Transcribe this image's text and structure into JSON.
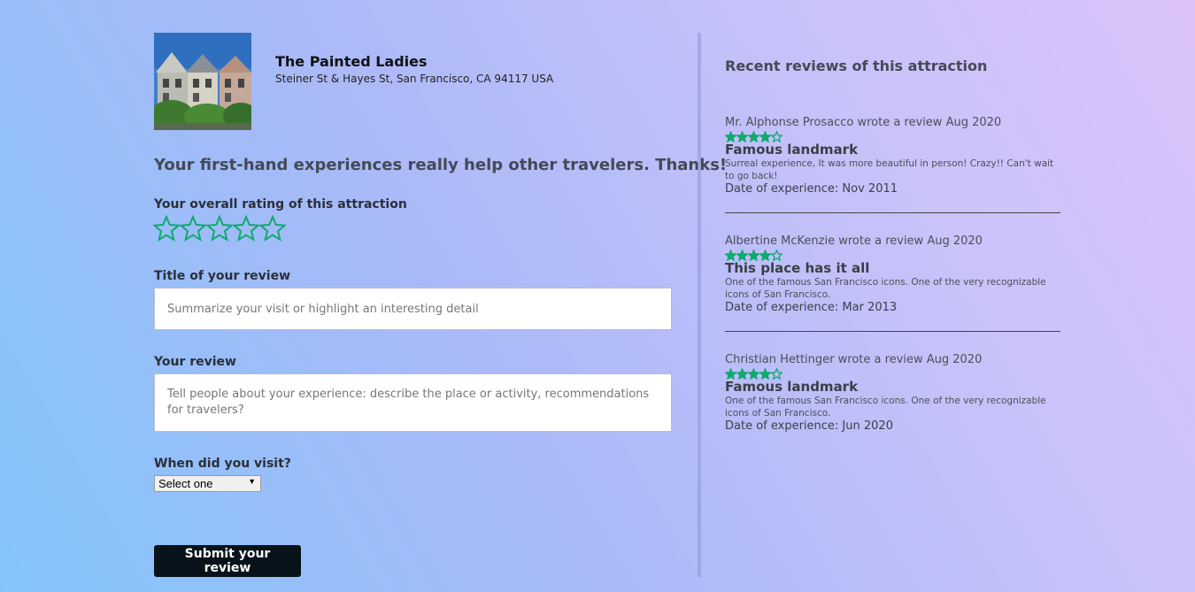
{
  "attraction": {
    "name": "The Painted Ladies",
    "address": "Steiner St & Hayes St, San Francisco, CA 94117 USA"
  },
  "form": {
    "thanks": "Your first-hand experiences really help other travelers. Thanks!",
    "rating_label": "Your overall rating of this attraction",
    "rating_value": 0,
    "rating_max": 5,
    "title_label": "Title of your review",
    "title_placeholder": "Summarize your visit or highlight an interesting detail",
    "title_value": "",
    "review_label": "Your review",
    "review_placeholder": "Tell people about your experience: describe the place or activity, recommendations for travelers?",
    "review_value": "",
    "visit_label": "When did you visit?",
    "visit_selected": "Select one",
    "submit_label": "Submit your review"
  },
  "recent": {
    "title": "Recent reviews of this attraction",
    "reviews": [
      {
        "byline": "Mr. Alphonse Prosacco wrote a review Aug 2020",
        "rating": 4,
        "title": "Famous landmark",
        "body": "Surreal experience, It was more beautiful in person! Crazy!! Can't wait to go back!",
        "date": "Date of experience: Nov 2011"
      },
      {
        "byline": "Albertine McKenzie wrote a review Aug 2020",
        "rating": 4,
        "title": "This place has it all",
        "body": "One of the famous San Francisco icons. One of the very recognizable icons of San Francisco.",
        "date": "Date of experience: Mar 2013"
      },
      {
        "byline": "Christian Hettinger wrote a review Aug 2020",
        "rating": 4,
        "title": "Famous landmark",
        "body": "One of the famous San Francisco icons. One of the very recognizable icons of San Francisco.",
        "date": "Date of experience: Jun 2020"
      }
    ]
  },
  "colors": {
    "star": "#10a96e",
    "submit_bg": "#08121b"
  }
}
